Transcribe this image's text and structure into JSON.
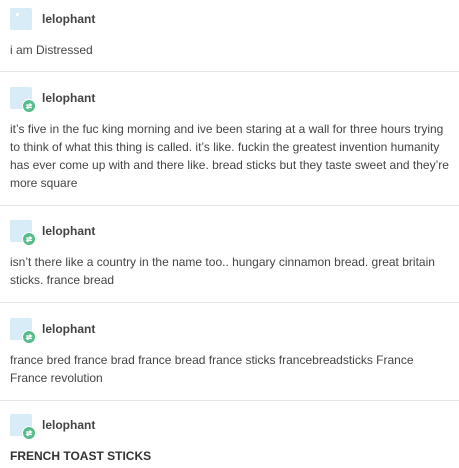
{
  "posts": [
    {
      "username": "lelophant",
      "avatar_icon": "avatar-icon",
      "reblog": false,
      "body": "i am Distressed",
      "bold": false
    },
    {
      "username": "lelophant",
      "avatar_icon": "avatar-icon",
      "reblog": true,
      "body": "it’s five in the fuc king morning and ive been staring at a wall for three hours trying to think of what this thing is called. it’s like. fuckin the greatest invention humanity has ever come up with and there like. bread sticks but they taste sweet and they’re more square",
      "bold": false
    },
    {
      "username": "lelophant",
      "avatar_icon": "avatar-icon",
      "reblog": true,
      "body": "isn’t there like a country in the name too.. hungary cinnamon bread. great britain sticks. france bread",
      "bold": false
    },
    {
      "username": "lelophant",
      "avatar_icon": "avatar-icon",
      "reblog": true,
      "body": "france bred france brad france bread france sticks francebreadsticks France France revolution",
      "bold": false
    },
    {
      "username": "lelophant",
      "avatar_icon": "avatar-icon",
      "reblog": true,
      "body": "FRENCH TOAST STICKS",
      "bold": true
    }
  ],
  "colors": {
    "avatar_bg": "#d7ecf7",
    "reblog_green": "#56bc8a",
    "text": "#444444",
    "divider": "#e6e6e6"
  }
}
